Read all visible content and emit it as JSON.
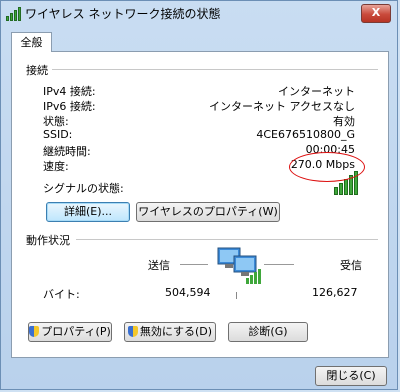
{
  "window": {
    "title": "ワイヤレス ネットワーク接続の状態",
    "close_glyph": "X"
  },
  "tabs": [
    {
      "label": "全般"
    }
  ],
  "connection": {
    "heading": "接続",
    "rows": [
      {
        "label": "IPv4 接続:",
        "value": "インターネット"
      },
      {
        "label": "IPv6 接続:",
        "value": "インターネット アクセスなし"
      },
      {
        "label": "状態:",
        "value": "有効"
      },
      {
        "label": "SSID:",
        "value": "4CE676510800_G"
      },
      {
        "label": "継続時間:",
        "value": "00:00:45"
      },
      {
        "label": "速度:",
        "value": "270.0 Mbps"
      }
    ],
    "signal_label": "シグナルの状態:",
    "signal_level": "5/5"
  },
  "buttons": {
    "details": "詳細(E)...",
    "wireless_props": "ワイヤレスのプロパティ(W)",
    "properties": "プロパティ(P)",
    "disable": "無効にする(D)",
    "diagnose": "診断(G)",
    "close": "閉じる(C)"
  },
  "activity": {
    "heading": "動作状況",
    "sent_label": "送信",
    "received_label": "受信",
    "bytes_label": "バイト:",
    "sent_value": "504,594",
    "received_value": "126,627"
  },
  "colors": {
    "accent": "#3fa73b",
    "highlight": "#d11111"
  }
}
